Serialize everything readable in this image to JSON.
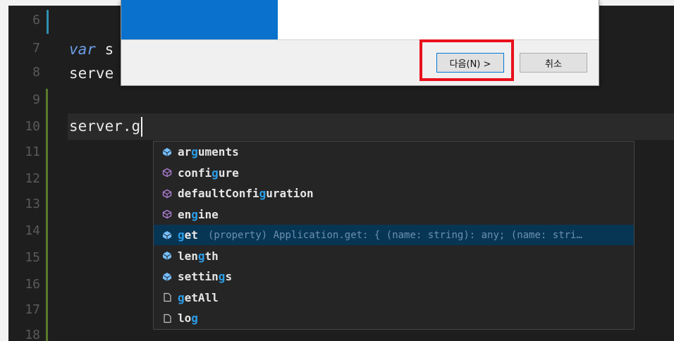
{
  "editor": {
    "line_numbers": [
      "6",
      "7",
      "8",
      "9",
      "10",
      "11",
      "12",
      "13",
      "14",
      "15",
      "16",
      "17",
      "18"
    ],
    "line7_kw": "var",
    "line7_rest": " s",
    "line8": "serve",
    "line10": "server.g"
  },
  "suggestions": [
    {
      "pre": "ar",
      "match": "g",
      "post": "uments",
      "icon": "property-icon"
    },
    {
      "pre": "confi",
      "match": "g",
      "post": "ure",
      "icon": "method-icon"
    },
    {
      "pre": "defaultConfi",
      "match": "g",
      "post": "uration",
      "icon": "method-icon"
    },
    {
      "pre": "en",
      "match": "g",
      "post": "ine",
      "icon": "method-icon"
    },
    {
      "pre": "",
      "match": "g",
      "post": "et",
      "icon": "property-icon",
      "detail": "(property) Application.get: { (name: string): any; (name: stri…",
      "selected": true
    },
    {
      "pre": "len",
      "match": "g",
      "post": "th",
      "icon": "property-icon"
    },
    {
      "pre": "settin",
      "match": "g",
      "post": "s",
      "icon": "property-icon"
    },
    {
      "pre": "",
      "match": "g",
      "post": "etAll",
      "icon": "file-icon"
    },
    {
      "pre": "lo",
      "match": "g",
      "post": "",
      "icon": "file-icon"
    }
  ],
  "dialog": {
    "next_label": "다음(N) >",
    "cancel_label": "취소"
  },
  "colors": {
    "accent_blue": "#0a72cc",
    "highlight_red": "#e8101c",
    "match_blue": "#2b9ee8"
  }
}
